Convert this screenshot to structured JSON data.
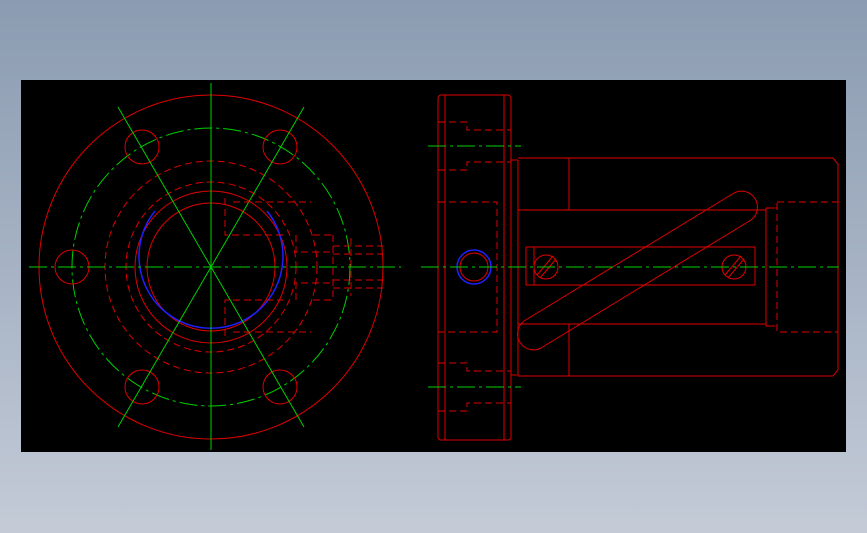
{
  "drawing": {
    "colors": {
      "background": "#000000",
      "outline": "#ff0000",
      "centerline": "#00ff00",
      "highlight": "#0000ff"
    },
    "views": [
      {
        "name": "front-view",
        "bolt_holes": 6,
        "line_styles": [
          "solid",
          "hidden",
          "center"
        ]
      },
      {
        "name": "side-view",
        "line_styles": [
          "solid",
          "hidden",
          "center"
        ]
      }
    ]
  }
}
